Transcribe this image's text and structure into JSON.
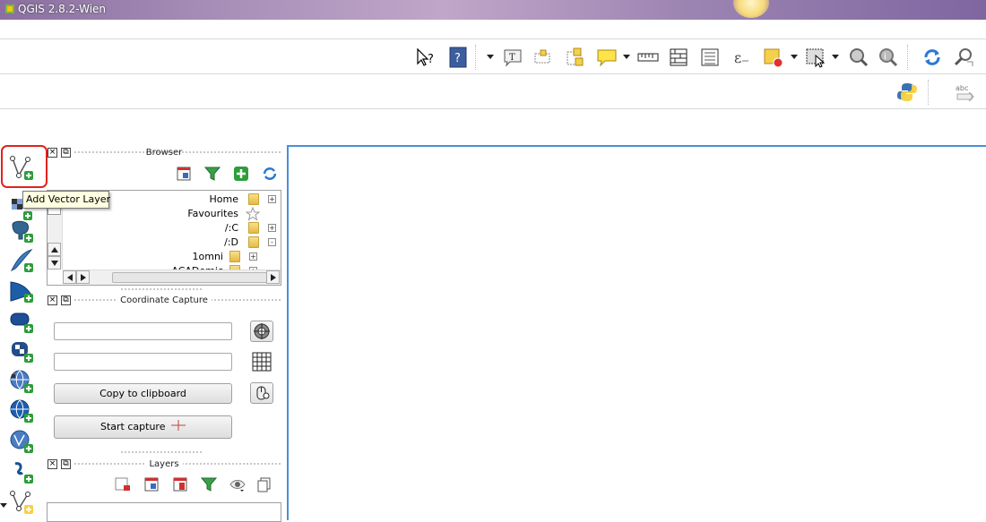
{
  "window": {
    "title": "QGIS 2.8.2-Wien"
  },
  "tooltip": {
    "text": "Add Vector Layer"
  },
  "toolbar_icons": [
    "whats-this-icon",
    "help-icon",
    "text-annotation-icon",
    "form-annotation-icon",
    "html-annotation-icon",
    "svg-annotation-icon",
    "measure-line-icon",
    "measure-area-icon",
    "field-calculator-icon",
    "expression-icon",
    "select-features-icon",
    "select-rectangle-icon",
    "identify-icon",
    "map-tips-icon",
    "refresh-icon",
    "zoom-search-icon",
    "python-console-icon",
    "label-icon"
  ],
  "left_toolbar_icons": [
    "add-vector-layer-icon",
    "add-raster-layer-icon",
    "add-postgis-layer-icon",
    "add-spatialite-layer-icon",
    "add-mssql-layer-icon",
    "add-oracle-layer-icon",
    "add-virtual-layer-icon",
    "add-wms-layer-icon",
    "add-wcs-layer-icon",
    "add-wfs-layer-icon",
    "add-delimited-text-icon",
    "new-shapefile-icon"
  ],
  "browser": {
    "title": "Browser",
    "items": [
      {
        "label": "Home",
        "icon": "folder",
        "expander": "+"
      },
      {
        "label": "Favourites",
        "icon": "star",
        "expander": ""
      },
      {
        "label": "/:C",
        "icon": "folder",
        "expander": "+"
      },
      {
        "label": "/:D",
        "icon": "folder",
        "expander": "-"
      },
      {
        "label": "1omni",
        "icon": "folder",
        "expander": "+"
      },
      {
        "label": "ACADemic",
        "icon": "folder",
        "expander": "+"
      }
    ]
  },
  "coordinate_capture": {
    "title": "Coordinate Capture",
    "field1_value": "",
    "field2_value": "",
    "copy_label": "Copy to clipboard",
    "start_label": "Start capture"
  },
  "layers": {
    "title": "Layers"
  },
  "dock_buttons": {
    "close": "×",
    "float": "⧉"
  },
  "colors": {
    "highlight": "#e0221e",
    "canvas_border": "#4a8fd8",
    "tooltip_bg": "#ffffe1"
  }
}
